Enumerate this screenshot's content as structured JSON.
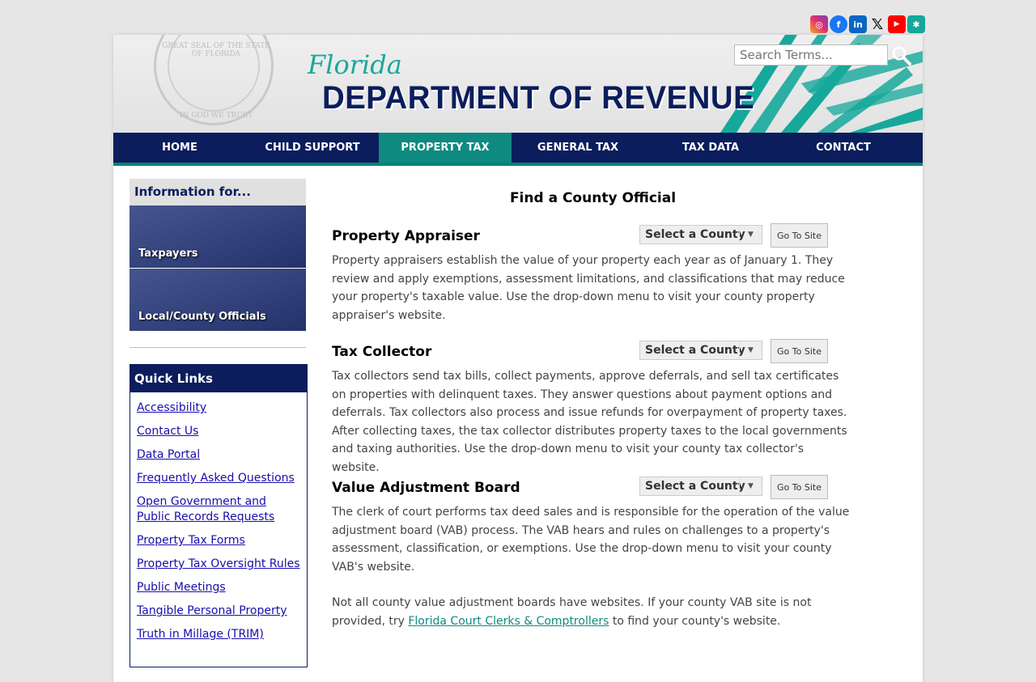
{
  "social": [
    {
      "name": "instagram-icon",
      "color": "#c13584",
      "glyph": "◎"
    },
    {
      "name": "facebook-icon",
      "color": "#1877f2",
      "glyph": "f"
    },
    {
      "name": "linkedin-icon",
      "color": "#0a66c2",
      "glyph": "in"
    },
    {
      "name": "x-icon",
      "color": "#ffffff",
      "glyph": "𝕏"
    },
    {
      "name": "youtube-icon",
      "color": "#ff0000",
      "glyph": "▶"
    },
    {
      "name": "palm-icon",
      "color": "#14a79a",
      "glyph": "✱"
    }
  ],
  "header": {
    "seal_top": "GREAT SEAL OF THE STATE OF FLORIDA",
    "seal_bottom": "IN GOD WE TRUST",
    "florida": "Florida",
    "department": "DEPARTMENT OF REVENUE",
    "search_placeholder": "Search Terms..."
  },
  "nav": [
    "HOME",
    "CHILD SUPPORT",
    "PROPERTY TAX",
    "GENERAL TAX",
    "TAX DATA",
    "CONTACT"
  ],
  "sidebar": {
    "info_title": "Information for...",
    "tiles": [
      "Taxpayers",
      "Local/County Officials"
    ],
    "quick_links_title": "Quick Links",
    "quick_links": [
      "Accessibility",
      "Contact Us",
      "Data Portal",
      "Frequently Asked Questions",
      "Open Government and Public Records Requests",
      "Property Tax Forms",
      "Property Tax Oversight Rules",
      "Public Meetings",
      "Tangible Personal Property",
      "Truth in Millage (TRIM)"
    ]
  },
  "main": {
    "title": "Find a County Official",
    "select_label": "Select a County",
    "go_label": "Go To Site",
    "sections": [
      {
        "title": "Property Appraiser",
        "desc": "Property appraisers establish the value of your property each year as of January 1. They review and apply exemptions, assessment limitations, and classifications that may reduce your property's taxable value. Use the drop-down menu to visit your county property appraiser's website."
      },
      {
        "title": "Tax Collector",
        "desc": "Tax collectors send tax bills, collect payments, approve deferrals, and sell tax certificates on properties with delinquent taxes. They answer questions about payment options and deferrals. Tax collectors also process and issue refunds for overpayment of property taxes. After collecting taxes, the tax collector distributes property taxes to the local governments and taxing authorities. Use the drop-down menu to visit your county tax collector's website."
      },
      {
        "title": "Value Adjustment Board",
        "desc": "The clerk of court performs tax deed sales and is responsible for the operation of the value adjustment board (VAB) process. The VAB hears and rules on challenges to a property's assessment, classification, or exemptions. Use the drop-down menu to visit your county VAB's website."
      }
    ],
    "note_before": "Not all county value adjustment boards have websites. If your county VAB site is not provided, try ",
    "note_link": "Florida Court Clerks & Comptrollers",
    "note_after": " to find your county's website."
  }
}
